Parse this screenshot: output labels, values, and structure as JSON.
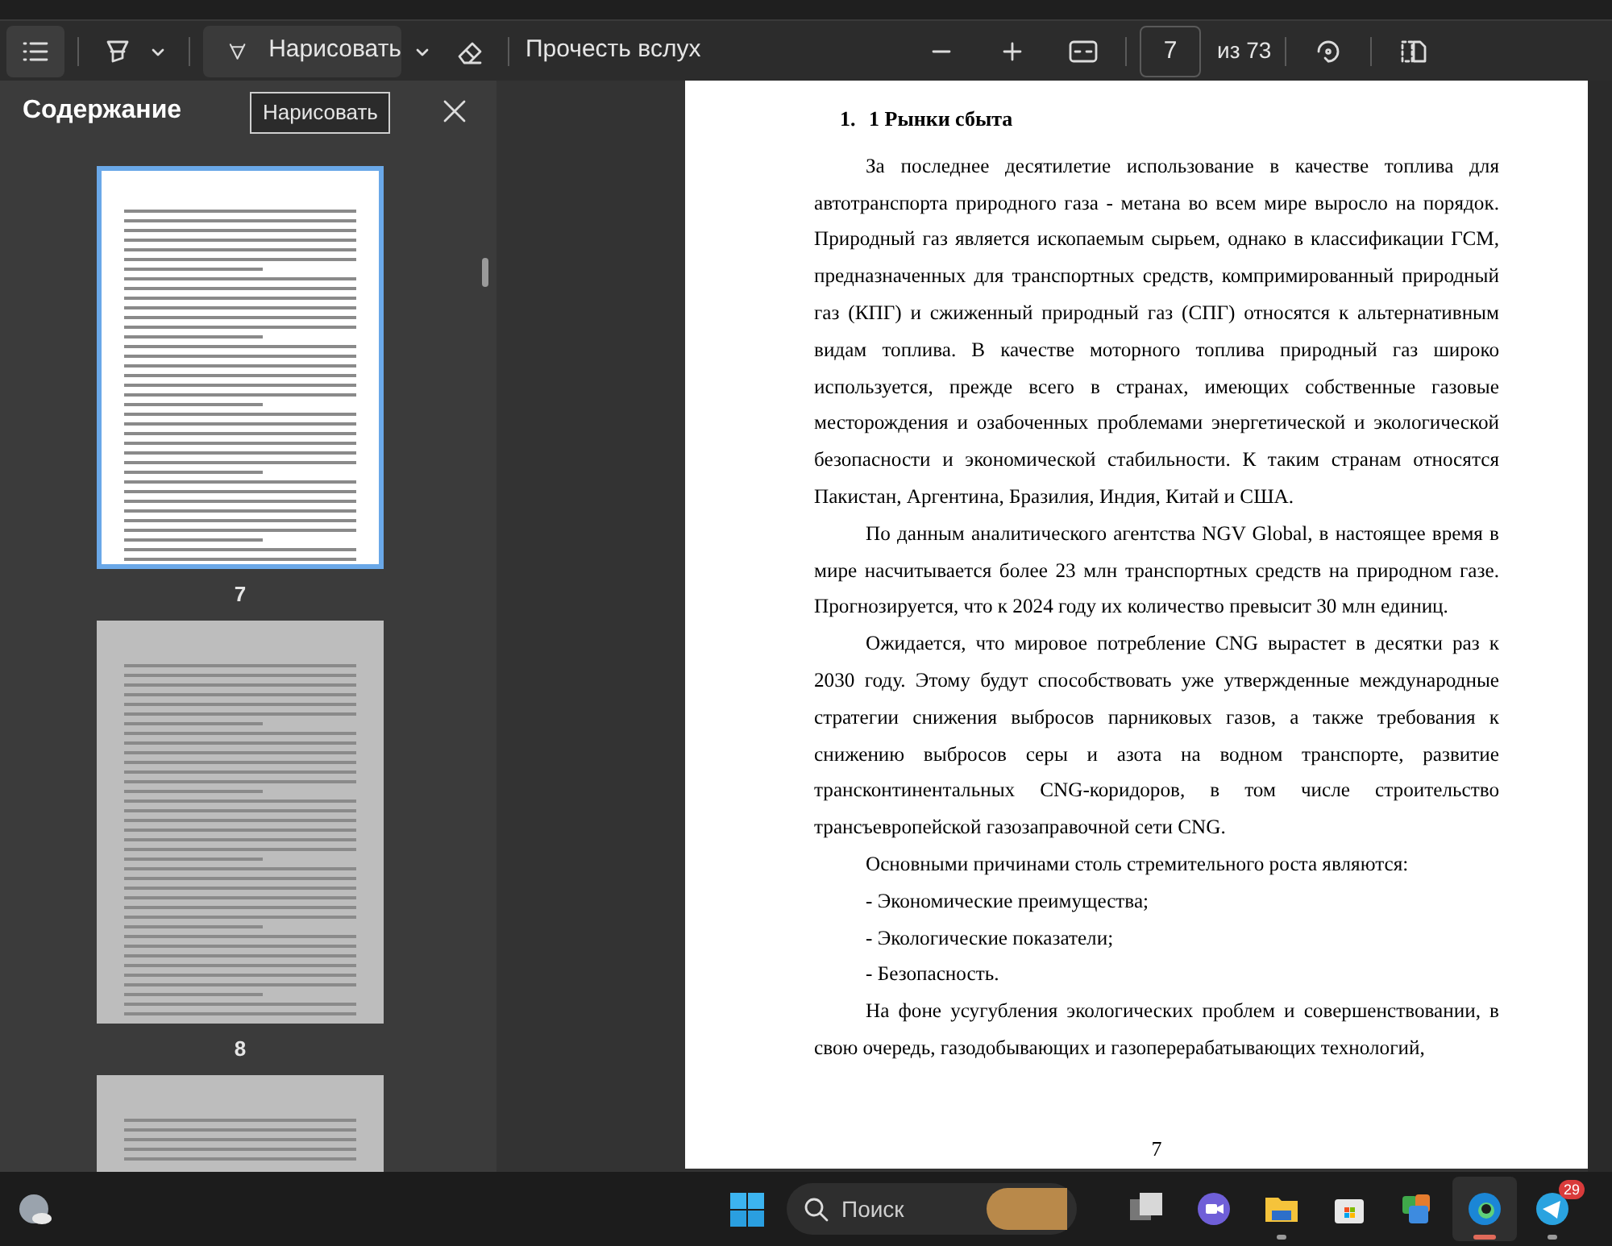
{
  "toolbar": {
    "left": [
      {
        "kind": "contents",
        "selected": true
      },
      {
        "kind": "highlight"
      },
      {
        "kind": "draw",
        "label": "Нарисовать"
      },
      {
        "kind": "erase"
      },
      {
        "kind": "read",
        "label": "Прочесть вслух"
      }
    ],
    "page_input": {
      "value": "7"
    },
    "page_total": "из 73"
  },
  "tooltip": "Нарисовать",
  "sidebar": {
    "title": "Содержание",
    "thumbnails": [
      {
        "label": "7",
        "selected": true
      },
      {
        "label": "8",
        "selected": false
      },
      {
        "selected": false
      }
    ]
  },
  "document": {
    "blocks": [
      {
        "kind": "heading",
        "number": "1.",
        "text": "1 Рынки сбыта"
      },
      {
        "kind": "para",
        "text": "За последнее десятилетие использование в качестве топлива для автотранспорта природного газа - метана во всем мире выросло на порядок. Природный газ является ископаемым сырьем, однако в классификации ГСМ, предназначенных для транспортных средств, компримированный природный газ (КПГ) и сжиженный природный газ (СПГ) относятся к альтернативным видам топлива. В качестве моторного топлива природный газ широко используется, прежде всего в странах, имеющих собственные газовые месторождения и озабоченных проблемами энергетической и экологической безопасности и экономической стабильности. К таким странам относятся Пакистан, Аргентина, Бразилия, Индия, Китай и США."
      },
      {
        "kind": "para",
        "text": "По данным аналитического агентства NGV Global, в настоящее время в мире насчитывается более 23 млн транспортных средств на природном газе. Прогнозируется, что к 2024 году их количество превысит 30 млн единиц."
      },
      {
        "kind": "para",
        "text": "Ожидается, что мировое потребление CNG вырастет в десятки раз к 2030 году. Этому будут способствовать уже утвержденные международные стратегии снижения выбросов парниковых газов, а также требования к снижению выбросов серы и азота на водном транспорте, развитие трансконтинентальных CNG-коридоров, в том числе строительство трансъевропейской газозаправочной сети CNG."
      },
      {
        "kind": "para",
        "text": "Основными причинами столь стремительного роста являются:"
      },
      {
        "kind": "list",
        "text": "- Экономические преимущества;"
      },
      {
        "kind": "list",
        "text": "- Экологические показатели;"
      },
      {
        "kind": "list",
        "text": "- Безопасность."
      },
      {
        "kind": "para",
        "text": "На фоне усугубления экологических проблем и совершенствовании, в свою очередь, газодобывающих и газоперерабатывающих технологий,"
      }
    ],
    "page_number": "7"
  },
  "taskbar": {
    "search_placeholder": "Поиск",
    "apps": [
      {
        "kind": "taskview",
        "running": false,
        "active": false
      },
      {
        "kind": "meet",
        "running": false,
        "active": false
      },
      {
        "kind": "explorer",
        "running": true,
        "active": false
      },
      {
        "kind": "store",
        "running": false,
        "active": false
      },
      {
        "kind": "cards",
        "running": false,
        "active": false
      },
      {
        "kind": "edge",
        "running": true,
        "active": true
      },
      {
        "kind": "telegram",
        "running": true,
        "active": false,
        "badge": "29"
      }
    ]
  }
}
